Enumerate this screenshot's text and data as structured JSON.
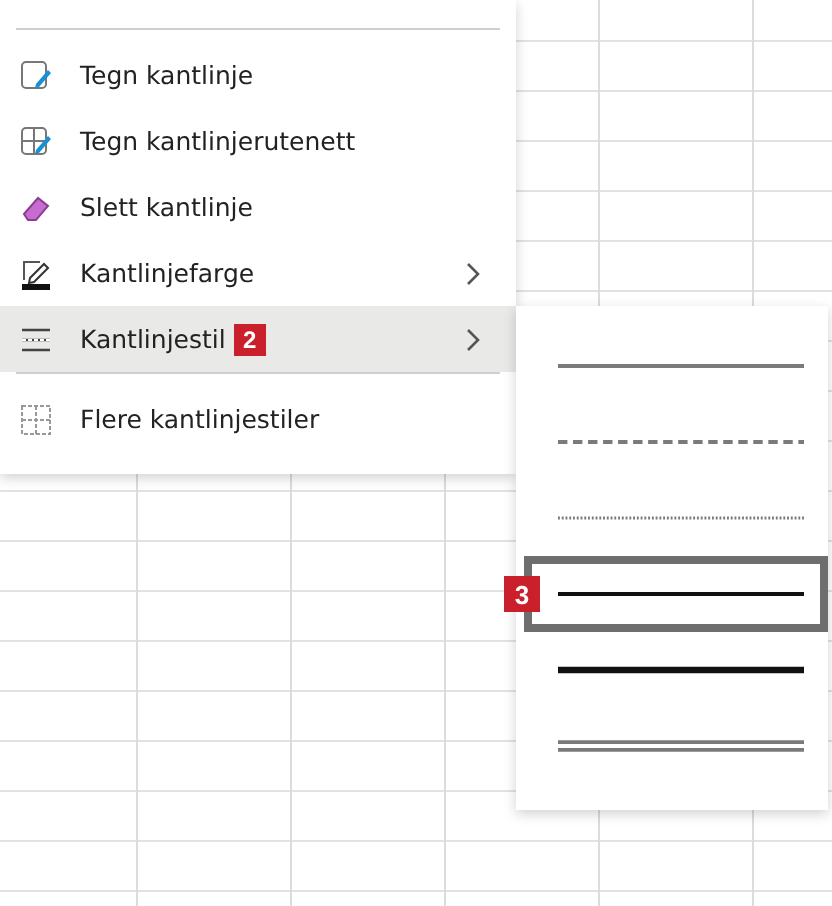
{
  "menu": {
    "entries": [
      {
        "kind": "divider"
      },
      {
        "kind": "item",
        "label": "Tegn kantlinje",
        "submenu": false,
        "highlighted": false
      },
      {
        "kind": "item",
        "label": "Tegn kantlinjerutenett",
        "submenu": false,
        "highlighted": false
      },
      {
        "kind": "item",
        "label": "Slett kantlinje",
        "submenu": false,
        "highlighted": false
      },
      {
        "kind": "item",
        "label": "Kantlinjefarge",
        "submenu": true,
        "highlighted": false
      },
      {
        "kind": "item",
        "label": "Kantlinjestil",
        "submenu": true,
        "highlighted": true,
        "badge": "2"
      },
      {
        "kind": "divider"
      },
      {
        "kind": "item",
        "label": "Flere kantlinjestiler",
        "submenu": false,
        "highlighted": false
      }
    ]
  },
  "line_styles": [
    {
      "kind": "solid",
      "selected": false
    },
    {
      "kind": "dashed",
      "selected": false
    },
    {
      "kind": "dotted",
      "selected": false
    },
    {
      "kind": "medium",
      "selected": true,
      "badge": "3"
    },
    {
      "kind": "thick",
      "selected": false
    },
    {
      "kind": "double",
      "selected": false
    }
  ]
}
